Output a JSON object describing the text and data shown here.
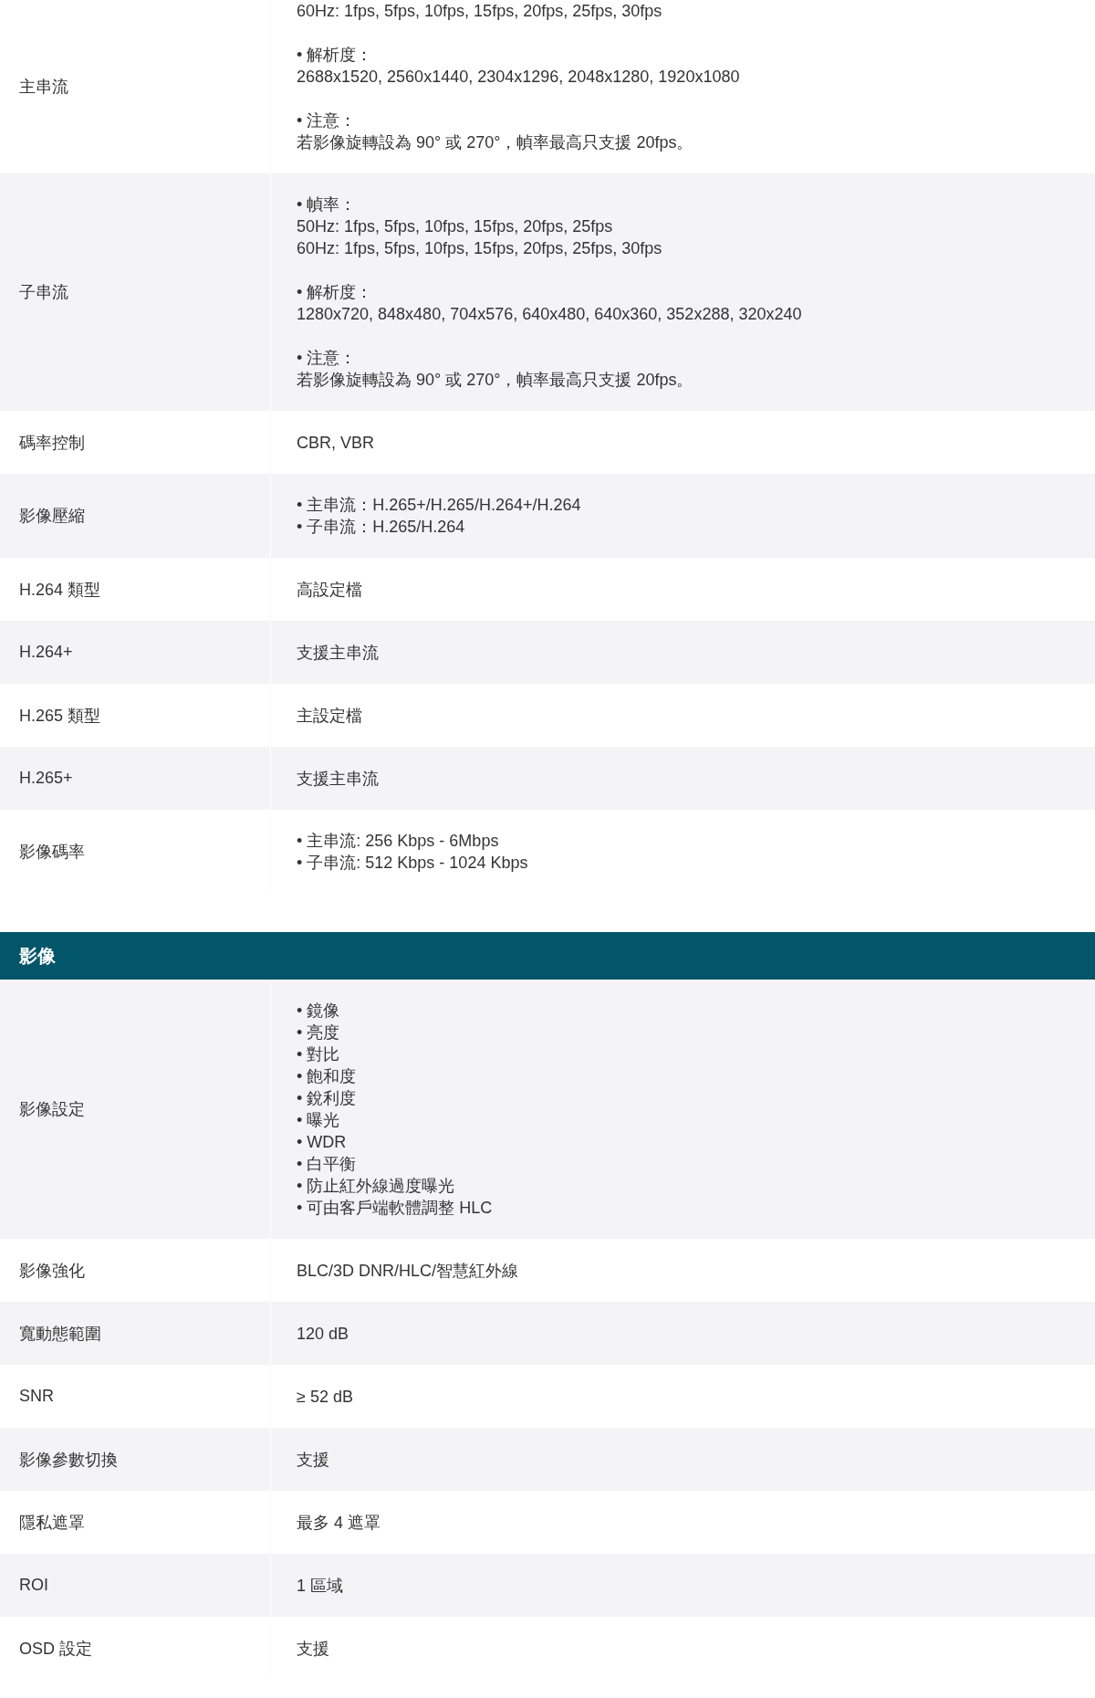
{
  "sections": [
    {
      "rows": [
        {
          "label": "主串流",
          "blocks": [
            [
              "60Hz: 1fps, 5fps, 10fps, 15fps, 20fps, 25fps, 30fps"
            ],
            [
              "• 解析度：",
              "2688x1520, 2560x1440, 2304x1296, 2048x1280, 1920x1080"
            ],
            [
              "• 注意：",
              "若影像旋轉設為 90° 或 270°，幀率最高只支援 20fps。"
            ]
          ]
        },
        {
          "label": "子串流",
          "blocks": [
            [
              "• 幀率：",
              "50Hz: 1fps, 5fps, 10fps, 15fps, 20fps, 25fps",
              "60Hz: 1fps, 5fps, 10fps, 15fps, 20fps, 25fps, 30fps"
            ],
            [
              "• 解析度：",
              "1280x720, 848x480, 704x576, 640x480, 640x360, 352x288, 320x240"
            ],
            [
              "• 注意：",
              "若影像旋轉設為 90° 或 270°，幀率最高只支援 20fps。"
            ]
          ]
        },
        {
          "label": "碼率控制",
          "blocks": [
            [
              "CBR, VBR"
            ]
          ]
        },
        {
          "label": "影像壓縮",
          "blocks": [
            [
              "• 主串流：H.265+/H.265/H.264+/H.264",
              "• 子串流：H.265/H.264"
            ]
          ]
        },
        {
          "label": "H.264 類型",
          "blocks": [
            [
              "高設定檔"
            ]
          ]
        },
        {
          "label": "H.264+",
          "blocks": [
            [
              "支援主串流"
            ]
          ]
        },
        {
          "label": "H.265 類型",
          "blocks": [
            [
              "主設定檔"
            ]
          ]
        },
        {
          "label": "H.265+",
          "blocks": [
            [
              "支援主串流"
            ]
          ]
        },
        {
          "label": "影像碼率",
          "blocks": [
            [
              "• 主串流: 256 Kbps - 6Mbps",
              "• 子串流: 512 Kbps - 1024 Kbps"
            ]
          ]
        }
      ]
    },
    {
      "title": "影像",
      "rows": [
        {
          "label": "影像設定",
          "blocks": [
            [
              "• 鏡像",
              "• 亮度",
              "• 對比",
              "• 飽和度",
              "• 銳利度",
              "• 曝光",
              "• WDR",
              "• 白平衡",
              "• 防止紅外線過度曝光",
              "• 可由客戶端軟體調整 HLC"
            ]
          ]
        },
        {
          "label": "影像強化",
          "blocks": [
            [
              "BLC/3D DNR/HLC/智慧紅外線"
            ]
          ]
        },
        {
          "label": "寬動態範圍",
          "blocks": [
            [
              "120 dB"
            ]
          ]
        },
        {
          "label": "SNR",
          "blocks": [
            [
              "≥ 52 dB"
            ]
          ]
        },
        {
          "label": "影像參數切換",
          "blocks": [
            [
              "支援"
            ]
          ]
        },
        {
          "label": "隱私遮罩",
          "blocks": [
            [
              "最多 4 遮罩"
            ]
          ]
        },
        {
          "label": "ROI",
          "blocks": [
            [
              "1 區域"
            ]
          ]
        },
        {
          "label": "OSD 設定",
          "blocks": [
            [
              "支援"
            ]
          ]
        }
      ]
    }
  ]
}
